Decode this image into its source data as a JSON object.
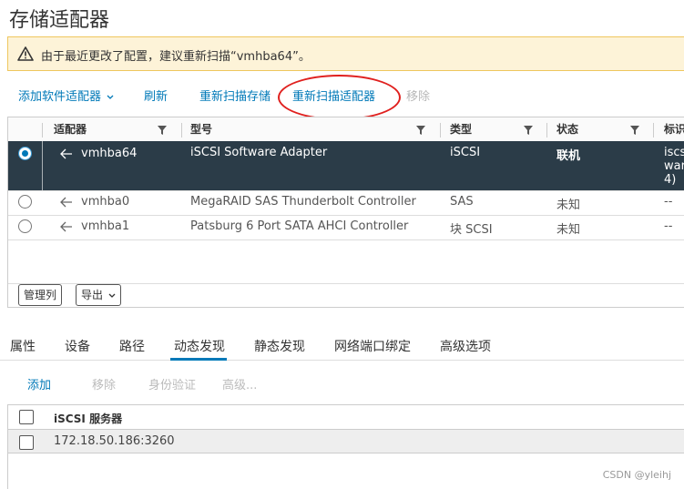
{
  "page_title": "存储适配器",
  "warning": {
    "icon": "warning-triangle-icon",
    "text": "由于最近更改了配置，建议重新扫描“vmhba64”。"
  },
  "toolbar": {
    "add_software_adapter": "添加软件适配器",
    "refresh": "刷新",
    "rescan_storage": "重新扫描存储",
    "rescan_adapter": "重新扫描适配器",
    "remove": "移除"
  },
  "adapters_grid": {
    "columns": [
      "适配器",
      "型号",
      "类型",
      "状态",
      "标识"
    ],
    "rows": [
      {
        "adapter": "vmhba64",
        "model": "iSCSI Software Adapter",
        "type": "iSCSI",
        "status": "联机",
        "id_line1": "iscs",
        "id_line2": "war",
        "id_line3": "4)",
        "selected": true
      },
      {
        "adapter": "vmhba0",
        "model": "MegaRAID SAS Thunderbolt Controller",
        "type": "SAS",
        "status": "未知",
        "id_line1": "--",
        "selected": false
      },
      {
        "adapter": "vmhba1",
        "model": "Patsburg 6 Port SATA AHCI Controller",
        "type": "块 SCSI",
        "status": "未知",
        "id_line1": "--",
        "selected": false
      }
    ],
    "manage_columns": "管理列",
    "export": "导出"
  },
  "detail_tabs": [
    "属性",
    "设备",
    "路径",
    "动态发现",
    "静态发现",
    "网络端口绑定",
    "高级选项"
  ],
  "active_tab": "动态发现",
  "discovery_actions": {
    "add": "添加",
    "remove": "移除",
    "auth": "身份验证",
    "advanced": "高级..."
  },
  "servers_grid": {
    "header": "iSCSI 服务器",
    "rows": [
      "172.18.50.186:3260"
    ]
  },
  "watermark": "CSDN @yleihj",
  "colors": {
    "accent": "#0079b8",
    "selected_row": "#2b3c48",
    "warning_bg": "#fdf3d8",
    "highlight_ellipse": "#e0201e"
  }
}
